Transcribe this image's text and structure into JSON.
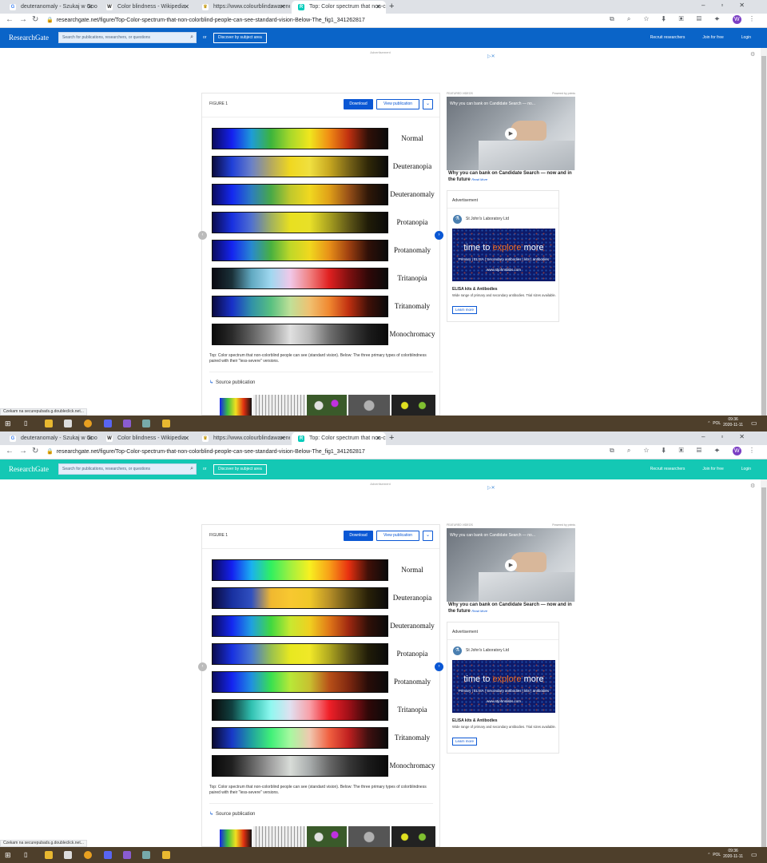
{
  "screens": [
    {
      "header_color": "#0a64c8",
      "tabs": [
        {
          "label": "deuteranomaly - Szukaj w Googl",
          "icon": "google-icon",
          "active": false
        },
        {
          "label": "Color blindness - Wikipedia",
          "icon": "wikipedia-icon",
          "active": false
        },
        {
          "label": "https://www.colourblindawarene",
          "icon": "colourblind-site-icon",
          "active": false
        },
        {
          "label": "Top: Color spectrum that non-col",
          "icon": "researchgate-icon",
          "active": true
        }
      ],
      "url": "researchgate.net/figure/Top-Color-spectrum-that-non-colorblind-people-can-see-standard-vision-Below-The_fig1_341262817",
      "spectra": [
        {
          "label": "Normal",
          "stops": [
            "#0b0b5e",
            "#1420f0",
            "#1e9bd8",
            "#3cb43c",
            "#a8d82a",
            "#f0e61e",
            "#f08c14",
            "#c03010",
            "#301008",
            "#0a0a0a"
          ]
        },
        {
          "label": "Deuteranopia",
          "stops": [
            "#0b0b3e",
            "#2040d8",
            "#6a80c8",
            "#b4a860",
            "#f0d820",
            "#f0e040",
            "#c8a820",
            "#786418",
            "#302808",
            "#0a0a0a"
          ]
        },
        {
          "label": "Deuteranomaly",
          "stops": [
            "#0b0b5e",
            "#1428f0",
            "#2c7cc0",
            "#48a848",
            "#c0c82c",
            "#f0d820",
            "#e0a018",
            "#985018",
            "#301808",
            "#0a0a0a"
          ]
        },
        {
          "label": "Protanopia",
          "stops": [
            "#0b0b4e",
            "#1830e0",
            "#5070d0",
            "#a0b060",
            "#e8e020",
            "#e8e028",
            "#a8a020",
            "#605818",
            "#201c08",
            "#0a0a0a"
          ]
        },
        {
          "label": "Protanomaly",
          "stops": [
            "#0b0b5e",
            "#1424f0",
            "#2888d0",
            "#48b040",
            "#c0d828",
            "#f0d81e",
            "#e89018",
            "#a04010",
            "#301008",
            "#0a0a0a"
          ]
        },
        {
          "label": "Tritanopia",
          "stops": [
            "#0a0a12",
            "#1a3038",
            "#60a8c0",
            "#a0d8f0",
            "#f0c8e8",
            "#f08080",
            "#e02020",
            "#801010",
            "#300808",
            "#0a0a0a"
          ]
        },
        {
          "label": "Tritanomaly",
          "stops": [
            "#0a0a40",
            "#1830c8",
            "#3090a8",
            "#58c080",
            "#c0e098",
            "#f0c070",
            "#f08830",
            "#c03010",
            "#401008",
            "#0a0a0a"
          ]
        },
        {
          "label": "Monochromacy",
          "stops": [
            "#0a0a0a",
            "#2a2a2a",
            "#606060",
            "#9a9a9a",
            "#e0e0e0",
            "#b8b8b8",
            "#707070",
            "#404040",
            "#1c1c1c",
            "#0a0a0a"
          ]
        }
      ],
      "clock_time": "09:36",
      "clock_date": "2020-11-11"
    },
    {
      "header_color": "#14c8b4",
      "tabs": [
        {
          "label": "deuteranomaly - Szukaj w Googl",
          "icon": "google-icon",
          "active": false
        },
        {
          "label": "Color blindness - Wikipedia",
          "icon": "wikipedia-icon",
          "active": false
        },
        {
          "label": "https://www.colourblindawarene",
          "icon": "colourblind-site-icon",
          "active": false
        },
        {
          "label": "Top: Color spectrum that non-col",
          "icon": "researchgate-icon",
          "active": true
        }
      ],
      "url": "researchgate.net/figure/Top-Color-spectrum-that-non-colorblind-people-can-see-standard-vision-Below-The_fig1_341262817",
      "spectra": [
        {
          "label": "Normal",
          "stops": [
            "#0b0b5e",
            "#1420f0",
            "#1ab0f0",
            "#30f060",
            "#a0f040",
            "#f8f020",
            "#f8a018",
            "#e83010",
            "#401008",
            "#0a0a0a"
          ]
        },
        {
          "label": "Deuteranopia",
          "stops": [
            "#0b0b3e",
            "#1830a0",
            "#3050c0",
            "#f0b830",
            "#f8c830",
            "#f0c828",
            "#b89028",
            "#685418",
            "#282008",
            "#0a0a0a"
          ]
        },
        {
          "label": "Deuteranomaly",
          "stops": [
            "#0b0b5e",
            "#1428f0",
            "#20a0e0",
            "#40d840",
            "#c8e830",
            "#f0d020",
            "#e07818",
            "#a02810",
            "#301008",
            "#0a0a0a"
          ]
        },
        {
          "label": "Protanopia",
          "stops": [
            "#0b0b4e",
            "#1830e0",
            "#4878d0",
            "#98c050",
            "#e8e820",
            "#f0e828",
            "#b0a820",
            "#605818",
            "#201c08",
            "#0a0a0a"
          ]
        },
        {
          "label": "Protanomaly",
          "stops": [
            "#0b0b5e",
            "#1424f0",
            "#2090e0",
            "#38e050",
            "#b8e838",
            "#c8c030",
            "#b85018",
            "#802810",
            "#280c08",
            "#0a0a0a"
          ]
        },
        {
          "label": "Tritanopia",
          "stops": [
            "#0a0a0a",
            "#104040",
            "#30c0b0",
            "#90f8f0",
            "#e0e0f0",
            "#f8a0a8",
            "#f02028",
            "#a01018",
            "#300808",
            "#0a0a0a"
          ]
        },
        {
          "label": "Tritanomaly",
          "stops": [
            "#0a0a30",
            "#1838c8",
            "#20a0a0",
            "#40f078",
            "#a8f8a0",
            "#f0c8b0",
            "#f06040",
            "#c02020",
            "#401010",
            "#0a0a0a"
          ]
        },
        {
          "label": "Monochromacy",
          "stops": [
            "#0a0a0a",
            "#202020",
            "#606060",
            "#a0a0a0",
            "#d8dcd8",
            "#a8acac",
            "#686868",
            "#383838",
            "#1a1a1a",
            "#0a0a0a"
          ]
        }
      ],
      "clock_time": "09:36",
      "clock_date": "2020-11-11"
    }
  ],
  "header": {
    "logo": "ResearchGate",
    "search_placeholder": "Search for publications, researchers, or questions",
    "or": "or",
    "discover": "Discover by subject area",
    "recruit": "Recruit researchers",
    "join": "Join for free",
    "login": "Login"
  },
  "advert_label": "Advertisement",
  "figure": {
    "title": "FIGURE 1",
    "download": "Download",
    "view_publication": "View publication",
    "caption": "Top: Color spectrum that non-colorblind people can see (standard vision). Below: The three primary types of colorblindness paired with their \"less-severe\" versions.",
    "source_publication": "Source publication"
  },
  "video": {
    "featured": "FEATURED VIDEOS",
    "powered": "Powered by primis",
    "overlay_title": "Why you can bank on Candidate Search — no...",
    "caption": "Why you can bank on Candidate Search — now and in the future",
    "read_more": "Read More"
  },
  "ad": {
    "label": "Advertisement",
    "company": "St John's Laboratory Ltd",
    "headline_a": "time to ",
    "headline_b": "explore",
    "headline_c": " more",
    "img_line": "Primary | ELISA | Secondary antibodies | kits | antibodies",
    "img_url": "www.stjohnslabs.com",
    "title": "ELISA kits & Antibodies",
    "text": "Wide range of primary and secondary antibodies. Trial sizes available.",
    "learn_more": "Learn more"
  },
  "status_text": "Czekam na securepubads.g.doubleclick.net...",
  "tray": {
    "lang": "POL"
  }
}
